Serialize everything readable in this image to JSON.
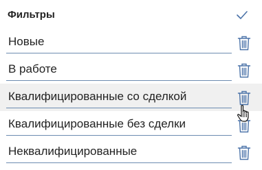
{
  "filters": {
    "title": "Фильтры",
    "confirm_icon": "check-icon",
    "delete_icon": "trash-icon",
    "items": [
      {
        "label": "Новые"
      },
      {
        "label": "В работе"
      },
      {
        "label": "Квалифицированные со сделкой",
        "hovered": true
      },
      {
        "label": "Квалифицированные без сделки"
      },
      {
        "label": "Неквалифицированные"
      }
    ]
  },
  "colors": {
    "accent": "#6b8bb0",
    "icon": "#4a72a8",
    "hover_bg": "#f0f0f0",
    "text": "#222222"
  }
}
